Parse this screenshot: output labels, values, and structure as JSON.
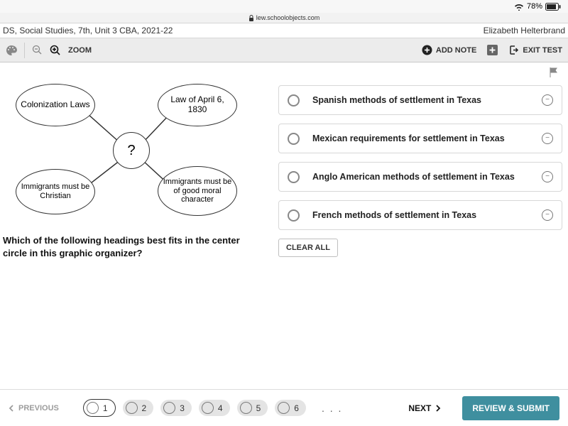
{
  "status": {
    "battery": "78%",
    "wifi_icon": "wifi-icon",
    "battery_icon": "battery-icon"
  },
  "url": {
    "lock_icon": "lock-icon",
    "host": "lew.schoolobjects.com"
  },
  "header": {
    "title_left": "DS, Social Studies, 7th, Unit 3 CBA, 2021-22",
    "user": "Elizabeth Helterbrand"
  },
  "toolbar": {
    "zoom_label": "ZOOM",
    "add_note_label": "ADD NOTE",
    "exit_test_label": "EXIT TEST"
  },
  "diagram": {
    "center": "?",
    "tl": "Colonization Laws",
    "tr": "Law of April 6, 1830",
    "bl": "Immigrants must be Christian",
    "br": "Immigrants must be of good moral character"
  },
  "question": "Which of the following headings best fits in the center circle in this graphic organizer?",
  "options": [
    {
      "label": "Spanish methods of settlement in Texas"
    },
    {
      "label": "Mexican requirements for settlement in Texas"
    },
    {
      "label": "Anglo American methods of settlement in Texas"
    },
    {
      "label": "French methods of settlement in Texas"
    }
  ],
  "clear_all": "CLEAR ALL",
  "footer": {
    "previous": "PREVIOUS",
    "pages": [
      "1",
      "2",
      "3",
      "4",
      "5",
      "6"
    ],
    "ellipsis": ". . .",
    "next": "NEXT",
    "submit": "REVIEW & SUBMIT"
  }
}
